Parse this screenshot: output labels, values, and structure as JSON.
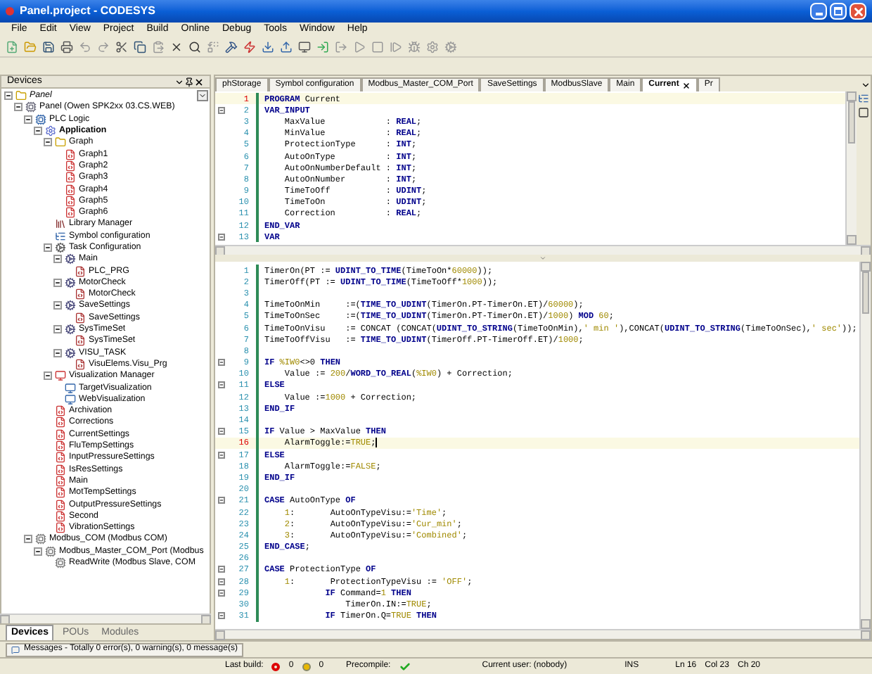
{
  "window": {
    "title": "Panel.project - CODESYS"
  },
  "menu": [
    "File",
    "Edit",
    "View",
    "Project",
    "Build",
    "Online",
    "Debug",
    "Tools",
    "Window",
    "Help"
  ],
  "devices": {
    "title": "Devices",
    "tree": [
      {
        "label": "Panel",
        "kind": "project",
        "expanded": true,
        "children": [
          {
            "label": "Panel (Owen SPK2xx 03.CS.WEB)",
            "kind": "device",
            "expanded": true,
            "children": [
              {
                "label": "PLC Logic",
                "kind": "plc",
                "expanded": true,
                "children": [
                  {
                    "label": "Application",
                    "kind": "application",
                    "expanded": true,
                    "children": [
                      {
                        "label": "Graph",
                        "kind": "folder",
                        "expanded": true,
                        "children": [
                          {
                            "label": "Graph1",
                            "kind": "pou"
                          },
                          {
                            "label": "Graph2",
                            "kind": "pou"
                          },
                          {
                            "label": "Graph3",
                            "kind": "pou"
                          },
                          {
                            "label": "Graph4",
                            "kind": "pou"
                          },
                          {
                            "label": "Graph5",
                            "kind": "pou"
                          },
                          {
                            "label": "Graph6",
                            "kind": "pou"
                          }
                        ]
                      },
                      {
                        "label": "Library Manager",
                        "kind": "library"
                      },
                      {
                        "label": "Symbol configuration",
                        "kind": "symbols"
                      },
                      {
                        "label": "Task Configuration",
                        "kind": "tasks",
                        "expanded": true,
                        "children": [
                          {
                            "label": "Main",
                            "kind": "task",
                            "expanded": true,
                            "children": [
                              {
                                "label": "PLC_PRG",
                                "kind": "call"
                              }
                            ]
                          },
                          {
                            "label": "MotorCheck",
                            "kind": "task",
                            "expanded": true,
                            "children": [
                              {
                                "label": "MotorCheck",
                                "kind": "call"
                              }
                            ]
                          },
                          {
                            "label": "SaveSettings",
                            "kind": "task",
                            "expanded": true,
                            "children": [
                              {
                                "label": "SaveSettings",
                                "kind": "call"
                              }
                            ]
                          },
                          {
                            "label": "SysTimeSet",
                            "kind": "task",
                            "expanded": true,
                            "children": [
                              {
                                "label": "SysTimeSet",
                                "kind": "call"
                              }
                            ]
                          },
                          {
                            "label": "VISU_TASK",
                            "kind": "task",
                            "expanded": true,
                            "children": [
                              {
                                "label": "VisuElems.Visu_Prg",
                                "kind": "call"
                              }
                            ]
                          }
                        ]
                      },
                      {
                        "label": "Visualization Manager",
                        "kind": "visumanager",
                        "expanded": true,
                        "children": [
                          {
                            "label": "TargetVisualization",
                            "kind": "visu"
                          },
                          {
                            "label": "WebVisualization",
                            "kind": "visu"
                          }
                        ]
                      },
                      {
                        "label": "Archivation",
                        "kind": "pou"
                      },
                      {
                        "label": "Corrections",
                        "kind": "pou"
                      },
                      {
                        "label": "CurrentSettings",
                        "kind": "pou"
                      },
                      {
                        "label": "FluTempSettings",
                        "kind": "pou"
                      },
                      {
                        "label": "InputPressureSettings",
                        "kind": "pou"
                      },
                      {
                        "label": "IsResSettings",
                        "kind": "pou"
                      },
                      {
                        "label": "Main",
                        "kind": "pou"
                      },
                      {
                        "label": "MotTempSettings",
                        "kind": "pou"
                      },
                      {
                        "label": "OutputPressureSettings",
                        "kind": "pou"
                      },
                      {
                        "label": "Second",
                        "kind": "pou"
                      },
                      {
                        "label": "VibrationSettings",
                        "kind": "pou"
                      }
                    ]
                  }
                ]
              },
              {
                "label": "Modbus_COM (Modbus COM)",
                "kind": "modbus",
                "expanded": true,
                "children": [
                  {
                    "label": "Modbus_Master_COM_Port (Modbus",
                    "kind": "modbus",
                    "expanded": true,
                    "children": [
                      {
                        "label": "ReadWrite (Modbus Slave, COM",
                        "kind": "modbus"
                      }
                    ]
                  }
                ]
              }
            ]
          }
        ]
      }
    ],
    "bottom_tabs": [
      {
        "label": "Devices",
        "selected": true
      },
      {
        "label": "POUs",
        "selected": false
      },
      {
        "label": "Modules",
        "selected": false
      }
    ]
  },
  "editor_tabs": [
    {
      "label": "phStorage",
      "selected": false
    },
    {
      "label": "Symbol configuration",
      "selected": false
    },
    {
      "label": "Modbus_Master_COM_Port",
      "selected": false
    },
    {
      "label": "SaveSettings",
      "selected": false
    },
    {
      "label": "ModbusSlave",
      "selected": false
    },
    {
      "label": "Main",
      "selected": false
    },
    {
      "label": "Current",
      "selected": true
    },
    {
      "label": "Pr",
      "selected": false
    }
  ],
  "declaration": [
    {
      "n": "1",
      "current": true,
      "fold": false,
      "tokens": [
        {
          "kind": "keyword",
          "text": "PROGRAM"
        },
        {
          "kind": "plain",
          "text": " Current"
        }
      ]
    },
    {
      "n": "2",
      "current": false,
      "fold": true,
      "tokens": [
        {
          "kind": "keyword",
          "text": "VAR_INPUT"
        }
      ]
    },
    {
      "n": "3",
      "current": false,
      "fold": false,
      "tokens": [
        {
          "kind": "plain",
          "text": "    MaxValue            : "
        },
        {
          "kind": "keyword",
          "text": "REAL"
        },
        {
          "kind": "plain",
          "text": ";"
        }
      ]
    },
    {
      "n": "4",
      "current": false,
      "fold": false,
      "tokens": [
        {
          "kind": "plain",
          "text": "    MinValue            : "
        },
        {
          "kind": "keyword",
          "text": "REAL"
        },
        {
          "kind": "plain",
          "text": ";"
        }
      ]
    },
    {
      "n": "5",
      "current": false,
      "fold": false,
      "tokens": [
        {
          "kind": "plain",
          "text": "    ProtectionType      : "
        },
        {
          "kind": "keyword",
          "text": "INT"
        },
        {
          "kind": "plain",
          "text": ";"
        }
      ]
    },
    {
      "n": "6",
      "current": false,
      "fold": false,
      "tokens": [
        {
          "kind": "plain",
          "text": "    AutoOnType          : "
        },
        {
          "kind": "keyword",
          "text": "INT"
        },
        {
          "kind": "plain",
          "text": ";"
        }
      ]
    },
    {
      "n": "7",
      "current": false,
      "fold": false,
      "tokens": [
        {
          "kind": "plain",
          "text": "    AutoOnNumberDefault : "
        },
        {
          "kind": "keyword",
          "text": "INT"
        },
        {
          "kind": "plain",
          "text": ";"
        }
      ]
    },
    {
      "n": "8",
      "current": false,
      "fold": false,
      "tokens": [
        {
          "kind": "plain",
          "text": "    AutoOnNumber        : "
        },
        {
          "kind": "keyword",
          "text": "INT"
        },
        {
          "kind": "plain",
          "text": ";"
        }
      ]
    },
    {
      "n": "9",
      "current": false,
      "fold": false,
      "tokens": [
        {
          "kind": "plain",
          "text": "    TimeToOff           : "
        },
        {
          "kind": "keyword",
          "text": "UDINT"
        },
        {
          "kind": "plain",
          "text": ";"
        }
      ]
    },
    {
      "n": "10",
      "current": false,
      "fold": false,
      "tokens": [
        {
          "kind": "plain",
          "text": "    TimeToOn            : "
        },
        {
          "kind": "keyword",
          "text": "UDINT"
        },
        {
          "kind": "plain",
          "text": ";"
        }
      ]
    },
    {
      "n": "11",
      "current": false,
      "fold": false,
      "tokens": [
        {
          "kind": "plain",
          "text": "    Correction          : "
        },
        {
          "kind": "keyword",
          "text": "REAL"
        },
        {
          "kind": "plain",
          "text": ";"
        }
      ]
    },
    {
      "n": "12",
      "current": false,
      "fold": false,
      "tokens": [
        {
          "kind": "keyword",
          "text": "END_VAR"
        }
      ]
    },
    {
      "n": "13",
      "current": false,
      "fold": true,
      "tokens": [
        {
          "kind": "keyword",
          "text": "VAR"
        }
      ]
    }
  ],
  "code": [
    {
      "n": "1",
      "current": false,
      "fold": false,
      "tokens": [
        {
          "kind": "plain",
          "text": "TimerOn(PT := "
        },
        {
          "kind": "keyword",
          "text": "UDINT_TO_TIME"
        },
        {
          "kind": "plain",
          "text": "(TimeToOn*"
        },
        {
          "kind": "literal",
          "text": "60000"
        },
        {
          "kind": "plain",
          "text": "));"
        }
      ]
    },
    {
      "n": "2",
      "current": false,
      "fold": false,
      "tokens": [
        {
          "kind": "plain",
          "text": "TimerOff(PT := "
        },
        {
          "kind": "keyword",
          "text": "UDINT_TO_TIME"
        },
        {
          "kind": "plain",
          "text": "(TimeToOff*"
        },
        {
          "kind": "literal",
          "text": "1000"
        },
        {
          "kind": "plain",
          "text": "));"
        }
      ]
    },
    {
      "n": "3",
      "current": false,
      "fold": false
    },
    {
      "n": "4",
      "current": false,
      "fold": false,
      "tokens": [
        {
          "kind": "plain",
          "text": "TimeToOnMin     :=("
        },
        {
          "kind": "keyword",
          "text": "TIME_TO_UDINT"
        },
        {
          "kind": "plain",
          "text": "(TimerOn.PT-TimerOn.ET)/"
        },
        {
          "kind": "literal",
          "text": "60000"
        },
        {
          "kind": "plain",
          "text": ");"
        }
      ]
    },
    {
      "n": "5",
      "current": false,
      "fold": false,
      "tokens": [
        {
          "kind": "plain",
          "text": "TimeToOnSec     :=("
        },
        {
          "kind": "keyword",
          "text": "TIME_TO_UDINT"
        },
        {
          "kind": "plain",
          "text": "(TimerOn.PT-TimerOn.ET)/"
        },
        {
          "kind": "literal",
          "text": "1000"
        },
        {
          "kind": "plain",
          "text": ") "
        },
        {
          "kind": "keyword",
          "text": "MOD"
        },
        {
          "kind": "literal",
          "text": " 60"
        },
        {
          "kind": "plain",
          "text": ";"
        }
      ]
    },
    {
      "n": "6",
      "current": false,
      "fold": false,
      "tokens": [
        {
          "kind": "plain",
          "text": "TimeToOnVisu    := CONCAT (CONCAT("
        },
        {
          "kind": "keyword",
          "text": "UDINT_TO_STRING"
        },
        {
          "kind": "plain",
          "text": "(TimeToOnMin),"
        },
        {
          "kind": "literal",
          "text": "' min '"
        },
        {
          "kind": "plain",
          "text": "),CONCAT("
        },
        {
          "kind": "keyword",
          "text": "UDINT_TO_STRING"
        },
        {
          "kind": "plain",
          "text": "(TimeToOnSec),"
        },
        {
          "kind": "literal",
          "text": "' sec'"
        },
        {
          "kind": "plain",
          "text": "));"
        }
      ]
    },
    {
      "n": "7",
      "current": false,
      "fold": false,
      "tokens": [
        {
          "kind": "plain",
          "text": "TimeToOffVisu   := "
        },
        {
          "kind": "keyword",
          "text": "TIME_TO_UDINT"
        },
        {
          "kind": "plain",
          "text": "(TimerOff.PT-TimerOff.ET)/"
        },
        {
          "kind": "literal",
          "text": "1000"
        },
        {
          "kind": "plain",
          "text": ";"
        }
      ]
    },
    {
      "n": "8",
      "current": false,
      "fold": false
    },
    {
      "n": "9",
      "current": false,
      "fold": true,
      "tokens": [
        {
          "kind": "keyword",
          "text": "IF"
        },
        {
          "kind": "literal",
          "text": " %IW0"
        },
        {
          "kind": "plain",
          "text": "<>0 "
        },
        {
          "kind": "keyword",
          "text": "THEN"
        }
      ]
    },
    {
      "n": "10",
      "current": false,
      "fold": false,
      "tokens": [
        {
          "kind": "plain",
          "text": "    Value := "
        },
        {
          "kind": "literal",
          "text": "200"
        },
        {
          "kind": "plain",
          "text": "/"
        },
        {
          "kind": "keyword",
          "text": "WORD_TO_REAL"
        },
        {
          "kind": "plain",
          "text": "("
        },
        {
          "kind": "literal",
          "text": "%IW0"
        },
        {
          "kind": "plain",
          "text": ") + Correction;"
        }
      ]
    },
    {
      "n": "11",
      "current": false,
      "fold": true,
      "tokens": [
        {
          "kind": "keyword",
          "text": "ELSE"
        }
      ]
    },
    {
      "n": "12",
      "current": false,
      "fold": false,
      "tokens": [
        {
          "kind": "plain",
          "text": "    Value :="
        },
        {
          "kind": "literal",
          "text": "1000"
        },
        {
          "kind": "plain",
          "text": " + Correction;"
        }
      ]
    },
    {
      "n": "13",
      "current": false,
      "fold": false,
      "tokens": [
        {
          "kind": "keyword",
          "text": "END_IF"
        }
      ]
    },
    {
      "n": "14",
      "current": false,
      "fold": false
    },
    {
      "n": "15",
      "current": false,
      "fold": true,
      "tokens": [
        {
          "kind": "keyword",
          "text": "IF"
        },
        {
          "kind": "plain",
          "text": " Value > MaxValue "
        },
        {
          "kind": "keyword",
          "text": "THEN"
        }
      ]
    },
    {
      "n": "16",
      "current": true,
      "fold": false,
      "tokens": [
        {
          "kind": "plain",
          "text": "    AlarmToggle:="
        },
        {
          "kind": "literal",
          "text": "TRUE"
        },
        {
          "kind": "plain",
          "text": ";"
        }
      ]
    },
    {
      "n": "17",
      "current": false,
      "fold": true,
      "tokens": [
        {
          "kind": "keyword",
          "text": "ELSE"
        }
      ]
    },
    {
      "n": "18",
      "current": false,
      "fold": false,
      "tokens": [
        {
          "kind": "plain",
          "text": "    AlarmToggle:="
        },
        {
          "kind": "literal",
          "text": "FALSE"
        },
        {
          "kind": "plain",
          "text": ";"
        }
      ]
    },
    {
      "n": "19",
      "current": false,
      "fold": false,
      "tokens": [
        {
          "kind": "keyword",
          "text": "END_IF"
        }
      ]
    },
    {
      "n": "20",
      "current": false,
      "fold": false
    },
    {
      "n": "21",
      "current": false,
      "fold": true,
      "tokens": [
        {
          "kind": "keyword",
          "text": "CASE"
        },
        {
          "kind": "plain",
          "text": " AutoOnType "
        },
        {
          "kind": "keyword",
          "text": "OF"
        }
      ]
    },
    {
      "n": "22",
      "current": false,
      "fold": false,
      "tokens": [
        {
          "kind": "literal",
          "text": "    1"
        },
        {
          "kind": "plain",
          "text": ":       AutoOnTypeVisu:="
        },
        {
          "kind": "literal",
          "text": "'Time'"
        },
        {
          "kind": "plain",
          "text": ";"
        }
      ]
    },
    {
      "n": "23",
      "current": false,
      "fold": false,
      "tokens": [
        {
          "kind": "literal",
          "text": "    2"
        },
        {
          "kind": "plain",
          "text": ":       AutoOnTypeVisu:="
        },
        {
          "kind": "literal",
          "text": "'Cur_min'"
        },
        {
          "kind": "plain",
          "text": ";"
        }
      ]
    },
    {
      "n": "24",
      "current": false,
      "fold": false,
      "tokens": [
        {
          "kind": "literal",
          "text": "    3"
        },
        {
          "kind": "plain",
          "text": ":       AutoOnTypeVisu:="
        },
        {
          "kind": "literal",
          "text": "'Combined'"
        },
        {
          "kind": "plain",
          "text": ";"
        }
      ]
    },
    {
      "n": "25",
      "current": false,
      "fold": false,
      "tokens": [
        {
          "kind": "keyword",
          "text": "END_CASE"
        },
        {
          "kind": "plain",
          "text": ";"
        }
      ]
    },
    {
      "n": "26",
      "current": false,
      "fold": false
    },
    {
      "n": "27",
      "current": false,
      "fold": true,
      "tokens": [
        {
          "kind": "keyword",
          "text": "CASE"
        },
        {
          "kind": "plain",
          "text": " ProtectionType "
        },
        {
          "kind": "keyword",
          "text": "OF"
        }
      ]
    },
    {
      "n": "28",
      "current": false,
      "fold": true,
      "tokens": [
        {
          "kind": "literal",
          "text": "    1"
        },
        {
          "kind": "plain",
          "text": ":       ProtectionTypeVisu := "
        },
        {
          "kind": "literal",
          "text": "'OFF'"
        },
        {
          "kind": "plain",
          "text": ";"
        }
      ]
    },
    {
      "n": "29",
      "current": false,
      "fold": true,
      "tokens": [
        {
          "kind": "keyword",
          "text": "            IF"
        },
        {
          "kind": "plain",
          "text": " Command="
        },
        {
          "kind": "literal",
          "text": "1"
        },
        {
          "kind": "keyword",
          "text": " THEN"
        }
      ]
    },
    {
      "n": "30",
      "current": false,
      "fold": false,
      "tokens": [
        {
          "kind": "plain",
          "text": "                TimerOn.IN:="
        },
        {
          "kind": "literal",
          "text": "TRUE"
        },
        {
          "kind": "plain",
          "text": ";"
        }
      ]
    },
    {
      "n": "31",
      "current": false,
      "fold": true,
      "tokens": [
        {
          "kind": "keyword",
          "text": "            IF"
        },
        {
          "kind": "plain",
          "text": " TimerOn.Q="
        },
        {
          "kind": "literal",
          "text": "TRUE"
        },
        {
          "kind": "keyword",
          "text": " THEN"
        }
      ]
    }
  ],
  "messages": {
    "label": "Messages - Totally 0 error(s), 0 warning(s), 0 message(s)"
  },
  "status_bar": {
    "last_build": "Last build:",
    "errors": "0",
    "warnings": "0",
    "precompile": "Precompile:",
    "precompile_ok": true,
    "user": "Current user: (nobody)",
    "mode": "INS",
    "line": "Ln 16",
    "col": "Col 23",
    "ch": "Ch 20"
  }
}
